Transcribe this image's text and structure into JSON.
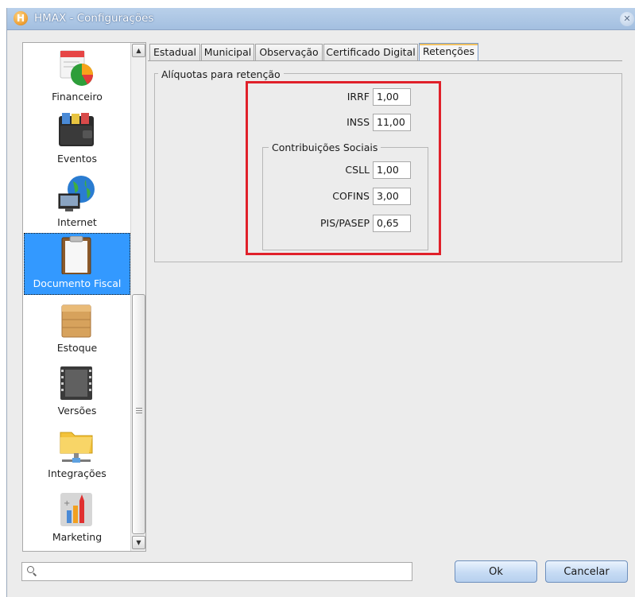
{
  "window": {
    "title": "HMAX - Configurações",
    "app_icon": "H"
  },
  "sidebar": {
    "items": [
      {
        "label": "Financeiro",
        "icon": "finance-pie-chart-icon"
      },
      {
        "label": "Eventos",
        "icon": "wallet-icon"
      },
      {
        "label": "Internet",
        "icon": "globe-computer-icon"
      },
      {
        "label": "Documento Fiscal",
        "icon": "clipboard-icon",
        "selected": true
      },
      {
        "label": "Estoque",
        "icon": "box-icon"
      },
      {
        "label": "Versões",
        "icon": "film-icon"
      },
      {
        "label": "Integrações",
        "icon": "folder-network-icon"
      },
      {
        "label": "Marketing",
        "icon": "bar-chart-arrow-icon"
      }
    ]
  },
  "tabs": [
    {
      "label": "Estadual"
    },
    {
      "label": "Municipal"
    },
    {
      "label": "Observação"
    },
    {
      "label": "Certificado Digital"
    },
    {
      "label": "Retenções",
      "active": true
    }
  ],
  "retencao": {
    "legend": "Alíquotas para retenção",
    "irrf": {
      "label": "IRRF",
      "value": "1,00"
    },
    "inss": {
      "label": "INSS",
      "value": "11,00"
    },
    "contribuicoes": {
      "legend": "Contribuições Sociais",
      "csll": {
        "label": "CSLL",
        "value": "1,00"
      },
      "cofins": {
        "label": "COFINS",
        "value": "3,00"
      },
      "pis": {
        "label": "PIS/PASEP",
        "value": "0,65"
      }
    }
  },
  "footer": {
    "search_value": "",
    "ok_label": "Ok",
    "cancel_label": "Cancelar"
  },
  "colors": {
    "highlight": "#e0202a",
    "selection": "#3399ff",
    "titlebar": "#a3bfe0"
  }
}
